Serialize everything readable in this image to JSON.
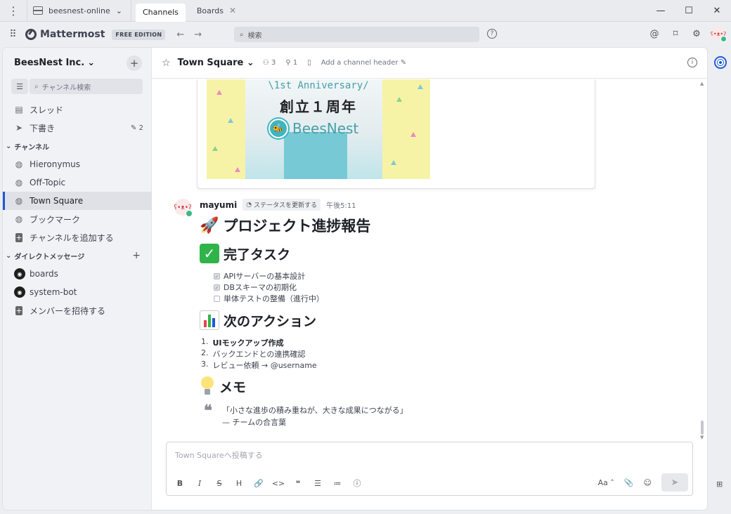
{
  "titlebar": {
    "server_name": "beesnest-online",
    "tabs": [
      {
        "label": "Channels",
        "active": true
      },
      {
        "label": "Boards",
        "active": false
      }
    ]
  },
  "header": {
    "brand": "Mattermost",
    "edition": "FREE EDITION",
    "search_placeholder": "検索"
  },
  "sidebar": {
    "team_name": "BeesNest Inc.",
    "channel_search_placeholder": "チャンネル検索",
    "threads_label": "スレッド",
    "drafts_label": "下書き",
    "drafts_count": "2",
    "channels_section": "チャンネル",
    "channels": [
      {
        "label": "Hieronymus",
        "active": false
      },
      {
        "label": "Off-Topic",
        "active": false
      },
      {
        "label": "Town Square",
        "active": true
      },
      {
        "label": "ブックマーク",
        "active": false
      }
    ],
    "add_channel": "チャンネルを追加する",
    "dm_section": "ダイレクトメッセージ",
    "dms": [
      {
        "label": "boards"
      },
      {
        "label": "system-bot"
      }
    ],
    "invite_members": "メンバーを招待する"
  },
  "channel": {
    "name": "Town Square",
    "member_count": "3",
    "pinned_count": "1",
    "header_placeholder": "Add a channel header"
  },
  "banner": {
    "anniversary": "\\1st Anniversary/",
    "title": "創立１周年",
    "brand": "BeesNest"
  },
  "post": {
    "username": "mayumi",
    "status_button": "ステータスを更新する",
    "time": "午後5:11",
    "heading_report": "プロジェクト進捗報告",
    "heading_done": "完了タスク",
    "tasks": [
      {
        "label": "APIサーバーの基本設計",
        "done": true
      },
      {
        "label": "DBスキーマの初期化",
        "done": true
      },
      {
        "label": "単体テストの整備（進行中）",
        "done": false
      }
    ],
    "heading_next": "次のアクション",
    "actions": [
      {
        "num": "1.",
        "label": "UIモックアップ作成"
      },
      {
        "num": "2.",
        "label": "バックエンドとの連携確認"
      },
      {
        "num": "3.",
        "label": "レビュー依頼 → @username"
      }
    ],
    "heading_memo": "メモ",
    "quote_line1": "「小さな進歩の積み重ねが、大きな成果につながる」",
    "quote_line2": "— チームの合言葉"
  },
  "composer": {
    "placeholder": "Town Squareへ投稿する",
    "font_toggle": "Aa"
  },
  "colors": {
    "accent": "#1c58d9",
    "online": "#3db887",
    "check": "#2fb44a"
  }
}
